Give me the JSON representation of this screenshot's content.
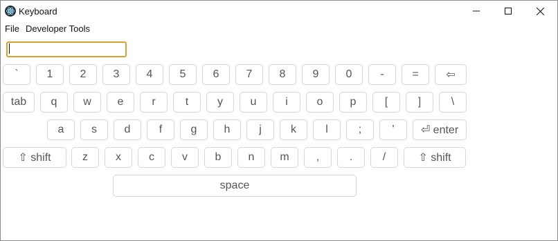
{
  "window": {
    "title": "Keyboard"
  },
  "menu": {
    "file": "File",
    "developer_tools": "Developer Tools"
  },
  "input": {
    "value": ""
  },
  "keyboard": {
    "row1": [
      "`",
      "1",
      "2",
      "3",
      "4",
      "5",
      "6",
      "7",
      "8",
      "9",
      "0",
      "-",
      "=",
      "⇦"
    ],
    "row2": [
      "tab",
      "q",
      "w",
      "e",
      "r",
      "t",
      "y",
      "u",
      "i",
      "o",
      "p",
      "[",
      "]",
      "\\"
    ],
    "row3": [
      "a",
      "s",
      "d",
      "f",
      "g",
      "h",
      "j",
      "k",
      "l",
      ";",
      "'",
      "⏎ enter"
    ],
    "row4": [
      "⇧ shift",
      "z",
      "x",
      "c",
      "v",
      "b",
      "n",
      "m",
      ",",
      ".",
      "/",
      "⇧ shift"
    ],
    "row5": [
      "space"
    ]
  },
  "colors": {
    "input_focus_border": "#d9a22e",
    "key_border": "#d6d6d6",
    "key_text": "#555555"
  }
}
